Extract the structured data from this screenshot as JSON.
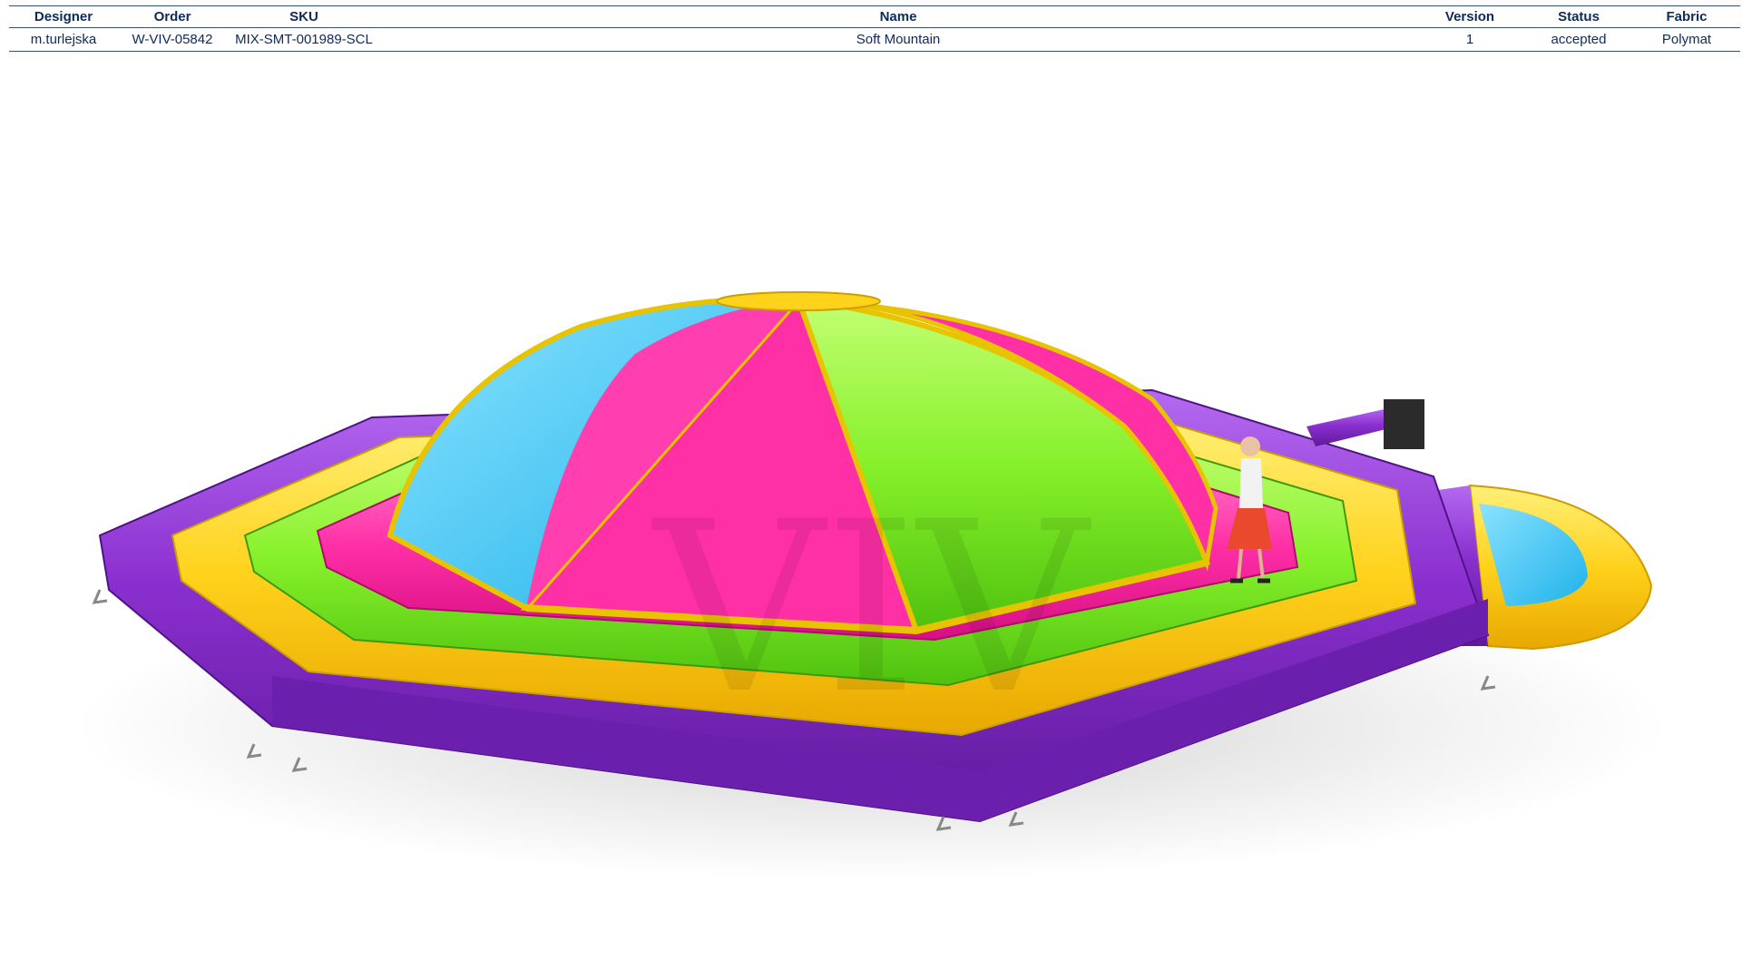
{
  "header": {
    "columns": [
      {
        "label": "Designer"
      },
      {
        "label": "Order"
      },
      {
        "label": "SKU"
      },
      {
        "label": "Name"
      },
      {
        "label": "Version"
      },
      {
        "label": "Status"
      },
      {
        "label": "Fabric"
      }
    ]
  },
  "record": {
    "designer": "m.turlejska",
    "order": "W-VIV-05842",
    "sku": "MIX-SMT-001989-SCL",
    "name": "Soft Mountain",
    "version": "1",
    "status": "accepted",
    "fabric": "Polymat"
  },
  "render": {
    "watermark": "VIV",
    "colors": {
      "purple": "#8a2fcf",
      "yellow": "#ffd21c",
      "green": "#86f02a",
      "pink": "#ff2fa6",
      "blue": "#4dcff6",
      "header_text": "#0d2a58"
    }
  }
}
